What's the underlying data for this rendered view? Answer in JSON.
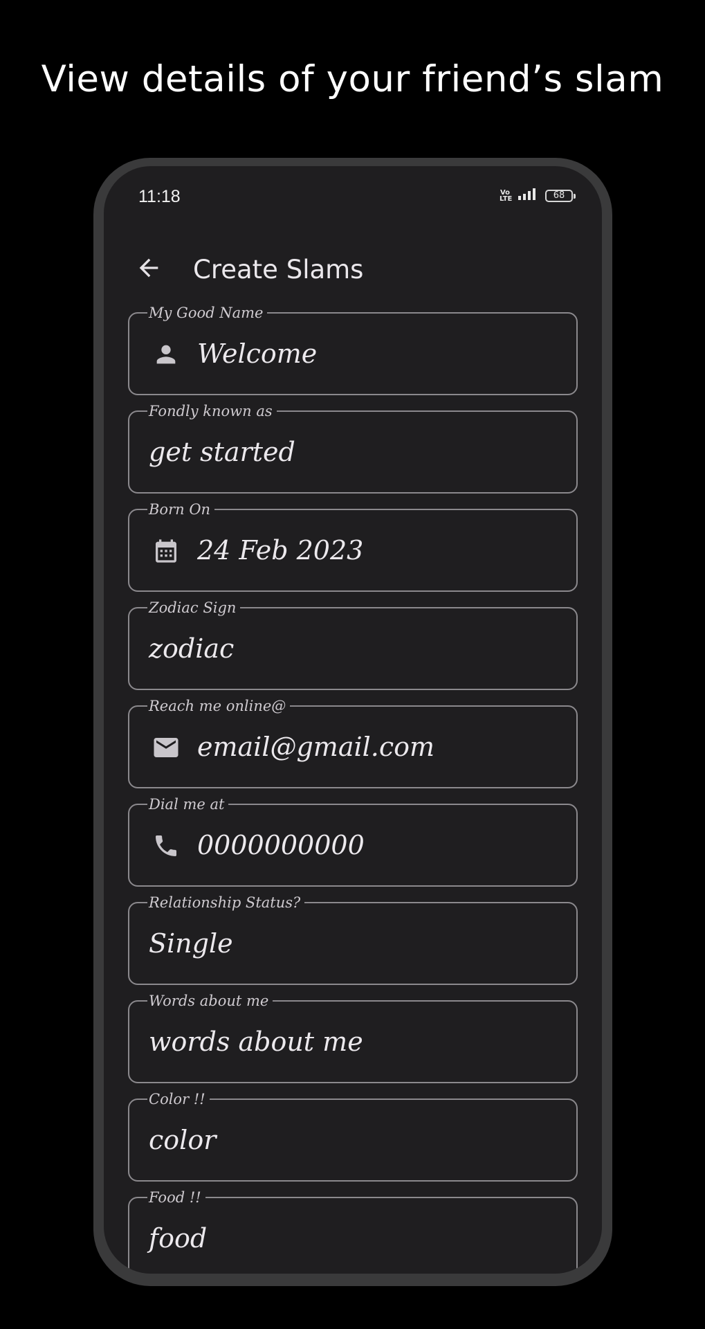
{
  "headline": "View details of your friend’s slam",
  "status_bar": {
    "time": "11:18",
    "network_label": "Vo LTE",
    "battery": "68",
    "icons": [
      "volte-icon",
      "signal-icon",
      "battery-icon"
    ]
  },
  "app_bar": {
    "title": "Create Slams",
    "back_icon": "arrow-back-icon"
  },
  "colors": {
    "background": "#000000",
    "phone_frame": "#3a3a3b",
    "screen": "#1f1e20",
    "field_border": "#8b898d",
    "text": "#ece9ed"
  },
  "form": {
    "fields": [
      {
        "label": "My Good Name",
        "value": "Welcome",
        "icon": "person-icon"
      },
      {
        "label": "Fondly known as",
        "value": "get started",
        "icon": null
      },
      {
        "label": "Born On",
        "value": "24 Feb 2023",
        "icon": "calendar-icon"
      },
      {
        "label": "Zodiac Sign",
        "value": "zodiac",
        "icon": null
      },
      {
        "label": "Reach me online@",
        "value": "email@gmail.com",
        "icon": "mail-icon"
      },
      {
        "label": "Dial me at",
        "value": "0000000000",
        "icon": "phone-icon"
      },
      {
        "label": "Relationship Status?",
        "value": "Single",
        "icon": null
      },
      {
        "label": "Words about me",
        "value": "words about me",
        "icon": null
      },
      {
        "label": "Color !!",
        "value": "color",
        "icon": null
      },
      {
        "label": "Food !!",
        "value": "food",
        "icon": null
      }
    ]
  }
}
